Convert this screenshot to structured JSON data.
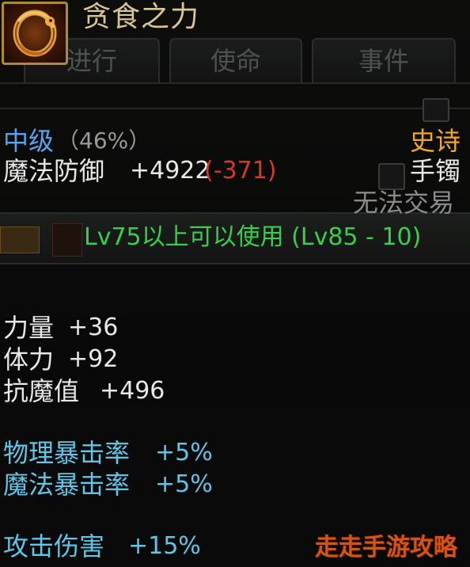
{
  "item": {
    "name": "贪食之力",
    "grade": "中级",
    "grade_percent": "（46%）",
    "rarity": "史诗",
    "slot_type": "手镯",
    "trade": "无法交易",
    "defense_label": "魔法防御",
    "defense_value": "+4922",
    "defense_diff": "(-371)",
    "level_requirement": "Lv75以上可以使用 (Lv85 - 10)",
    "stats": [
      {
        "label": "力量",
        "value": "+36"
      },
      {
        "label": "体力",
        "value": "+92"
      },
      {
        "label": "抗魔值",
        "value": "+496"
      }
    ],
    "crit_stats": [
      {
        "label": "物理暴击率",
        "value": "+5%"
      },
      {
        "label": "魔法暴击率",
        "value": "+5%"
      }
    ],
    "damage_stats": [
      {
        "label": "攻击伤害",
        "value": "+15%"
      }
    ]
  },
  "background_tabs": [
    "进行",
    "使命",
    "事件"
  ],
  "watermark": "走走手游攻略",
  "colors": {
    "title": "#d9c595",
    "grade": "#5aa2ea",
    "rarity": "#f0a826",
    "penalty": "#d23a2a",
    "requirement": "#38d04a",
    "crit": "#5fc6e8"
  },
  "icons": {
    "item_icon": "bracelet-dragon-icon"
  }
}
